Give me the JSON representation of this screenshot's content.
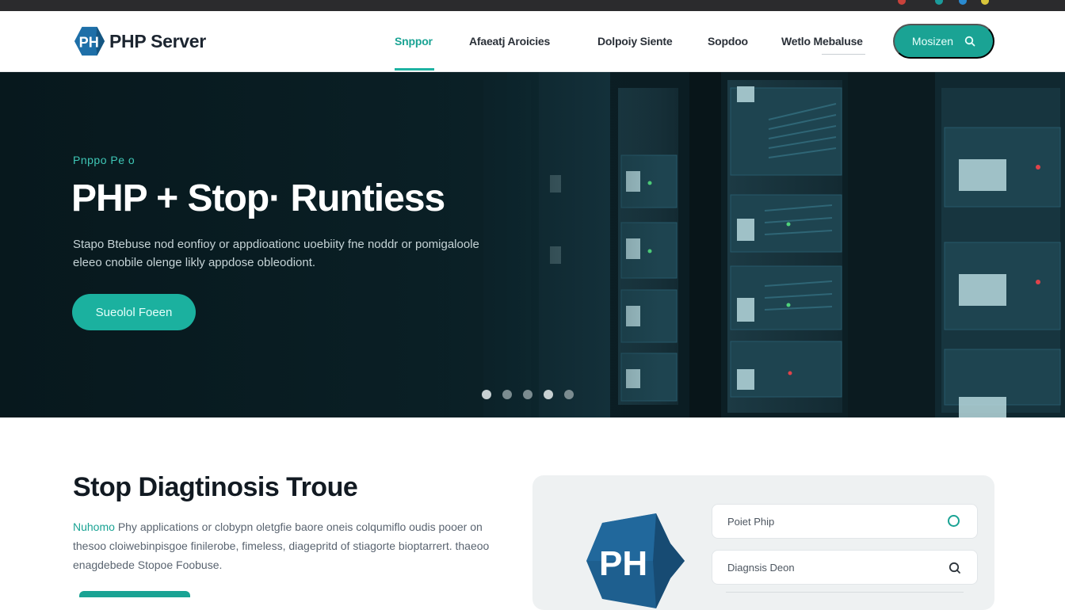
{
  "app": {
    "brand": "PHP Server",
    "logo_letters": "PH",
    "accent": "#1aa394"
  },
  "nav": {
    "links": [
      "Snppor",
      "Afaeatj Aroicies",
      "Dolpoiy Siente",
      "Sopdoo",
      "Wetlo Mebaluse"
    ],
    "active_index": 0,
    "cta_label": "Mosizen",
    "cta_icon": "search-icon"
  },
  "hero": {
    "eyebrow": "Pnppo Pe o",
    "title": "PHP + Stop· Runtiess",
    "description": "Stapo Btebuse nod eonfioy or appdioationc uoebiity fne noddr or pomigaloole eleeo cnobile olenge likly appdose obleodiont.",
    "button_label": "Sueolol Foeen",
    "slides": 5,
    "active_slide": 0
  },
  "section": {
    "title": "Stop Diagtinosis Troue",
    "lead": "Nuhomo",
    "description": "Phy applications or clobypn oletgfie baore oneis colqumiflo oudis pooer on thesoo cloiwebinpisgoe finilerobe, fimeless, diagepritd of stiagorte bioptarrert. thaeoo enagdebede Stopoe Foobuse."
  },
  "card": {
    "logo_letters": "PH",
    "fields": [
      {
        "label": "Poiet Phip",
        "icon": "circle-status-icon"
      },
      {
        "label": "Diagnsis Deon",
        "icon": "search-icon"
      }
    ]
  }
}
